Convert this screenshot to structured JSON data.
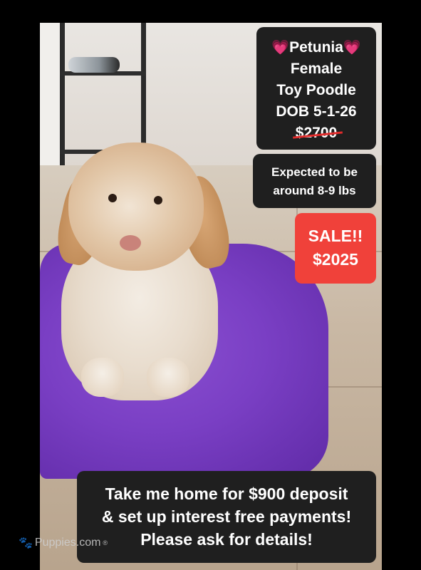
{
  "listing": {
    "name_line": "Petunia",
    "heart_glyph": "💗",
    "sex": "Female",
    "breed": "Toy Poodle",
    "dob": "DOB 5-1-26",
    "original_price": "$2700",
    "weight_line1": "Expected to be",
    "weight_line2": "around 8-9 lbs",
    "sale_label": "SALE!!",
    "sale_price": "$2025",
    "deposit_line1": "Take me home for $900 deposit",
    "deposit_line2": "& set up interest free payments!",
    "deposit_line3": "Please ask for details!"
  },
  "watermark": {
    "text": "Puppies.com",
    "mark": "®",
    "icon": "paw-icon"
  },
  "colors": {
    "box_bg": "#1f1f1f",
    "sale_bg": "#f0413a",
    "heart": "#ff7fb0",
    "blanket": "#7a3fc4"
  }
}
